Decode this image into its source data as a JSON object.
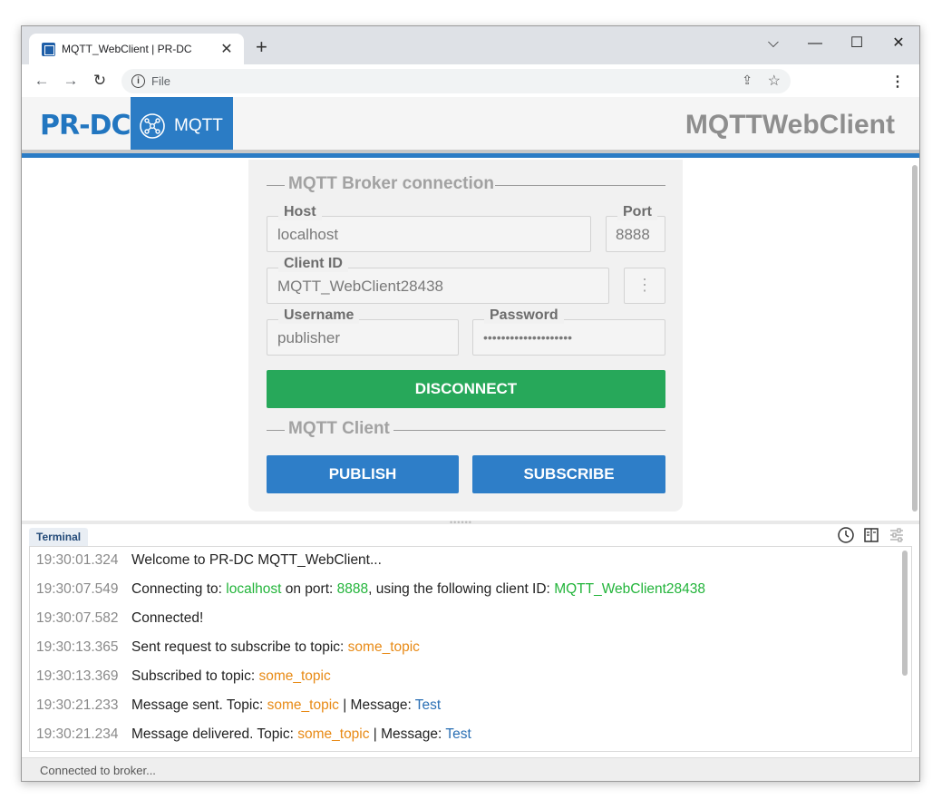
{
  "browser": {
    "tab_title": "MQTT_WebClient | PR-DC",
    "tab_close": "✕",
    "new_tab": "+",
    "address_scheme": "File",
    "controls": {
      "dropdown": "⌵",
      "minimize": "—",
      "maximize": "☐",
      "close": "✕"
    }
  },
  "header": {
    "logo": "PR-DC",
    "mqtt_tab_label": "MQTT",
    "app_title": "MQTTWebClient"
  },
  "broker": {
    "legend": "MQTT Broker connection",
    "host_label": "Host",
    "host_value": "localhost",
    "port_label": "Port",
    "port_value": "8888",
    "client_id_label": "Client ID",
    "client_id_value": "MQTT_WebClient28438",
    "username_label": "Username",
    "username_value": "publisher",
    "password_label": "Password",
    "password_value": "••••••••••••••••••••",
    "more_button": "⋮",
    "disconnect_label": "DISCONNECT"
  },
  "client": {
    "legend": "MQTT Client",
    "publish_label": "PUBLISH",
    "subscribe_label": "SUBSCRIBE"
  },
  "terminal": {
    "tab_label": "Terminal",
    "lines": [
      {
        "ts": "19:30:01.324",
        "parts": [
          {
            "t": "Welcome to PR-DC MQTT_WebClient...",
            "c": ""
          }
        ]
      },
      {
        "ts": "19:30:07.549",
        "parts": [
          {
            "t": "Connecting to: ",
            "c": ""
          },
          {
            "t": "localhost",
            "c": "g"
          },
          {
            "t": " on port: ",
            "c": ""
          },
          {
            "t": "8888",
            "c": "g"
          },
          {
            "t": ", using the following client ID: ",
            "c": ""
          },
          {
            "t": "MQTT_WebClient28438",
            "c": "g"
          }
        ]
      },
      {
        "ts": "19:30:07.582",
        "parts": [
          {
            "t": "Connected!",
            "c": ""
          }
        ]
      },
      {
        "ts": "19:30:13.365",
        "parts": [
          {
            "t": "Sent request to subscribe to topic: ",
            "c": ""
          },
          {
            "t": "some_topic",
            "c": "o"
          }
        ]
      },
      {
        "ts": "19:30:13.369",
        "parts": [
          {
            "t": "Subscribed to topic: ",
            "c": ""
          },
          {
            "t": "some_topic",
            "c": "o"
          }
        ]
      },
      {
        "ts": "19:30:21.233",
        "parts": [
          {
            "t": "Message sent. Topic: ",
            "c": ""
          },
          {
            "t": "some_topic",
            "c": "o"
          },
          {
            "t": " | Message: ",
            "c": ""
          },
          {
            "t": "Test",
            "c": "b"
          }
        ]
      },
      {
        "ts": "19:30:21.234",
        "parts": [
          {
            "t": "Message delivered. Topic: ",
            "c": ""
          },
          {
            "t": "some_topic",
            "c": "o"
          },
          {
            "t": " | Message: ",
            "c": ""
          },
          {
            "t": "Test",
            "c": "b"
          }
        ]
      }
    ]
  },
  "status": {
    "text": "Connected to broker..."
  },
  "colors": {
    "brand_blue": "#2b7cc5",
    "disconnect_green": "#27a85a",
    "highlight_green": "#22b43a",
    "topic_orange": "#e88a15",
    "message_blue": "#2a6fb4"
  }
}
